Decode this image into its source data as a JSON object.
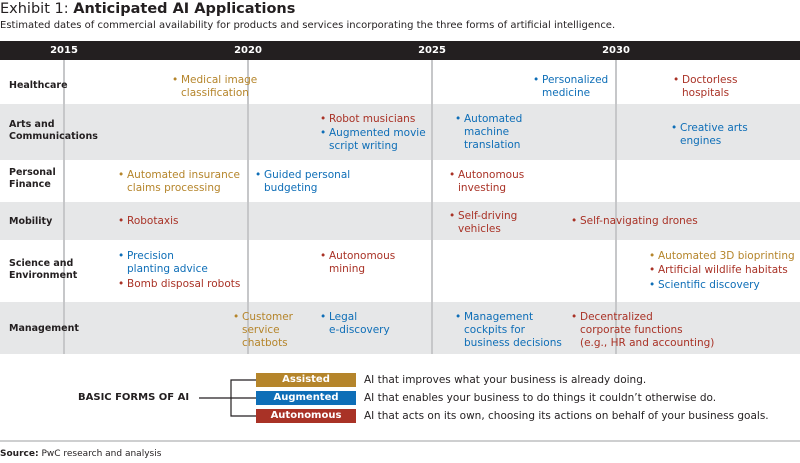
{
  "header": {
    "exhibit": "Exhibit 1:",
    "title": "Anticipated AI Applications",
    "subtitle": "Estimated dates of commercial availability for products and services incorporating the three forms of artificial intelligence."
  },
  "timeline": {
    "years": [
      "2015",
      "2020",
      "2025",
      "2030"
    ]
  },
  "rows": [
    {
      "label": [
        "Healthcare"
      ]
    },
    {
      "label": [
        "Arts and",
        "Communications"
      ]
    },
    {
      "label": [
        "Personal",
        "Finance"
      ]
    },
    {
      "label": [
        "Mobility"
      ]
    },
    {
      "label": [
        "Science and",
        "Environment"
      ]
    },
    {
      "label": [
        "Management"
      ]
    }
  ],
  "items": [
    {
      "text": [
        "Medical image",
        "classification"
      ],
      "type": "assisted"
    },
    {
      "text": [
        "Personalized",
        "medicine"
      ],
      "type": "augmented"
    },
    {
      "text": [
        "Doctorless",
        "hospitals"
      ],
      "type": "autonomous"
    },
    {
      "text": [
        "Robot musicians"
      ],
      "type": "autonomous"
    },
    {
      "text": [
        "Augmented movie",
        "script writing"
      ],
      "type": "augmented"
    },
    {
      "text": [
        "Automated",
        "machine",
        "translation"
      ],
      "type": "augmented"
    },
    {
      "text": [
        "Creative arts",
        "engines"
      ],
      "type": "augmented"
    },
    {
      "text": [
        "Automated insurance",
        "claims processing"
      ],
      "type": "assisted"
    },
    {
      "text": [
        "Guided personal",
        "budgeting"
      ],
      "type": "augmented"
    },
    {
      "text": [
        "Autonomous",
        "investing"
      ],
      "type": "autonomous"
    },
    {
      "text": [
        "Robotaxis"
      ],
      "type": "autonomous"
    },
    {
      "text": [
        "Self-driving",
        "vehicles"
      ],
      "type": "autonomous"
    },
    {
      "text": [
        "Self-navigating drones"
      ],
      "type": "autonomous"
    },
    {
      "text": [
        "Precision",
        "planting advice"
      ],
      "type": "augmented"
    },
    {
      "text": [
        "Bomb disposal robots"
      ],
      "type": "autonomous"
    },
    {
      "text": [
        "Autonomous",
        "mining"
      ],
      "type": "autonomous"
    },
    {
      "text": [
        "Automated 3D bioprinting"
      ],
      "type": "assisted"
    },
    {
      "text": [
        "Artificial wildlife habitats"
      ],
      "type": "autonomous"
    },
    {
      "text": [
        "Scientific discovery"
      ],
      "type": "augmented"
    },
    {
      "text": [
        "Customer",
        "service",
        "chatbots"
      ],
      "type": "assisted"
    },
    {
      "text": [
        "Legal",
        "e-discovery"
      ],
      "type": "augmented"
    },
    {
      "text": [
        "Management",
        "cockpits for",
        "business decisions"
      ],
      "type": "augmented"
    },
    {
      "text": [
        "Decentralized",
        "corporate functions",
        "(e.g., HR and accounting)"
      ],
      "type": "autonomous"
    }
  ],
  "legend": {
    "title": "BASIC FORMS OF AI",
    "entries": [
      {
        "name": "Assisted",
        "color": "#b5852b",
        "description": "AI that improves what your business is already doing."
      },
      {
        "name": "Augmented",
        "color": "#0e6eb7",
        "description": "AI that enables your business to do things it couldn’t otherwise do."
      },
      {
        "name": "Autonomous",
        "color": "#a93226",
        "description": "AI that acts on its own, choosing its actions on behalf of your business goals."
      }
    ]
  },
  "source": {
    "label": "Source:",
    "text": "PwC research and analysis"
  },
  "colors": {
    "assisted": "#b5852b",
    "augmented": "#0e6eb7",
    "autonomous": "#a93226",
    "band": "#e6e7e8",
    "header_bar": "#231f20"
  }
}
